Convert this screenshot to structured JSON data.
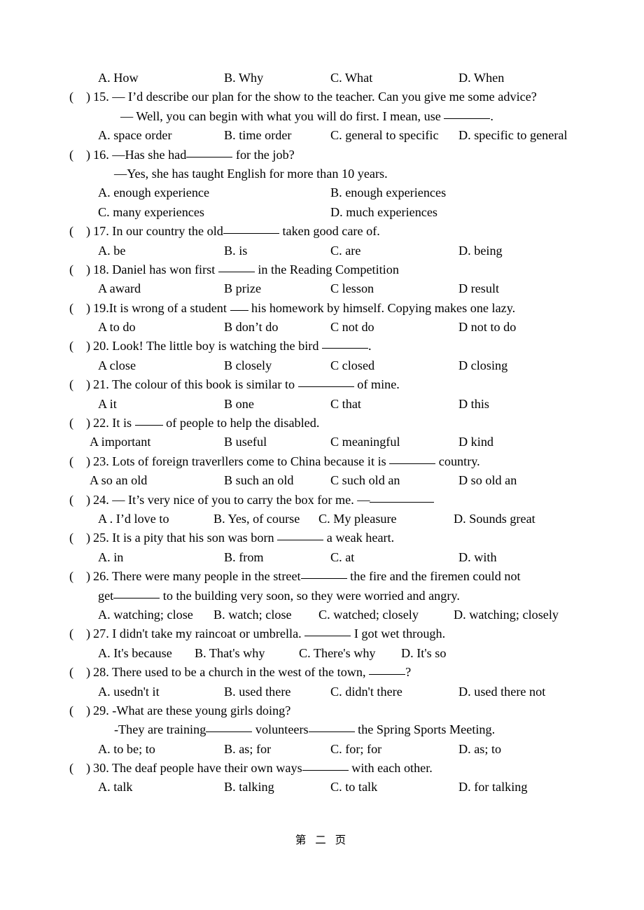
{
  "document": {
    "footer": "第 二 页",
    "bracket_open": "(",
    "bracket_close": ")"
  },
  "questions": [
    {
      "number": "",
      "options_layout": "four-column",
      "options": [
        "A. How",
        "B. Why",
        "C. What",
        "D. When"
      ]
    },
    {
      "number": "15.",
      "stem": "15. — I’d describe our plan for the show to the teacher. Can you give me some advice?",
      "stem_line2_pre": "— Well, you can begin with what you will do first. I mean, use ",
      "stem_line2_post": ".",
      "options_layout": "four-column",
      "options": [
        "A. space order",
        "B. time order",
        "C. general to specific",
        "D. specific to general"
      ]
    },
    {
      "number": "16.",
      "stem_pre": "16. —Has she had",
      "stem_post": " for the job?",
      "stem_line2": "—Yes, she has taught English for more than 10 years.",
      "options_layout": "two-column",
      "options": [
        "A. enough experience",
        "B. enough experiences",
        "C. many experiences",
        "D. much experiences"
      ]
    },
    {
      "number": "17.",
      "stem_pre": "17. In our country the old",
      "stem_post": " taken good care of.",
      "options_layout": "four-column",
      "options": [
        "A. be",
        "B. is",
        "C. are",
        "D. being"
      ]
    },
    {
      "number": "18.",
      "stem_pre": "18. Daniel has won first ",
      "stem_post": " in the Reading Competition",
      "options_layout": "four-column",
      "options": [
        "A award",
        "B prize",
        "C lesson",
        "D result"
      ]
    },
    {
      "number": "19.",
      "stem_pre": "19.It is wrong of a student ",
      "stem_post": " his homework by himself. Copying makes one lazy.",
      "options_layout": "four-column",
      "options": [
        "A to do",
        "B don’t do",
        "C not do",
        "D not to do"
      ]
    },
    {
      "number": "20.",
      "stem_pre": "20. Look! The little boy is watching the bird ",
      "stem_post": ".",
      "options_layout": "four-column",
      "options": [
        "A close",
        "B closely",
        "C closed",
        "D closing"
      ]
    },
    {
      "number": "21.",
      "stem_pre": "21. The colour of this book is similar to ",
      "stem_post": " of mine.",
      "options_layout": "four-column",
      "options": [
        "A it",
        "B one",
        "C that",
        "D this"
      ]
    },
    {
      "number": "22.",
      "stem_pre": "22. It is ",
      "stem_post": " of people to help the disabled.",
      "options_layout": "shift-left",
      "options": [
        "A important",
        "B useful",
        "C meaningful",
        "D kind"
      ]
    },
    {
      "number": "23.",
      "stem_pre": "23. Lots of foreign traverllers come to China because it is ",
      "stem_post": " country.",
      "options_layout": "shift-left",
      "options": [
        "A so an old",
        "B such an old",
        "C such old an",
        "D so old an"
      ]
    },
    {
      "number": "24.",
      "stem_pre": "24. — It’s very nice of you to carry the box for me. —",
      "stem_post": "",
      "options_layout": "flow-f",
      "options": [
        "A . I’d love to",
        "B. Yes, of course",
        "C. My pleasure",
        "D. Sounds great"
      ]
    },
    {
      "number": "25.",
      "stem_pre": "25. It is a pity that his son was born ",
      "stem_post": " a weak heart.",
      "options_layout": "four-column",
      "options": [
        "A. in",
        "B. from",
        "C. at",
        "D. with"
      ]
    },
    {
      "number": "26.",
      "stem_pre": "26. There were many people in the street",
      "stem_post": " the fire and the firemen could not",
      "stem_line2_pre": "get",
      "stem_line2_post": " to the building very soon, so they were worried and angry.",
      "options_layout": "flow-f",
      "options": [
        "A. watching; close",
        "B. watch; close",
        "C. watched; closely",
        "D. watching; closely"
      ]
    },
    {
      "number": "27.",
      "stem_pre": "27. I didn't take my raincoat or umbrella. ",
      "stem_post": " I got wet through.",
      "options_layout": "flow-g",
      "options": [
        "A. It's because",
        "B. That's why",
        "C. There's why",
        "D. It's so"
      ]
    },
    {
      "number": "28.",
      "stem_pre": "28. There used to be a church in the west of the town, ",
      "stem_post": "?",
      "options_layout": "four-column",
      "options": [
        "A. usedn't it",
        "B. used there",
        "C. didn't there",
        "D. used there not"
      ]
    },
    {
      "number": "29.",
      "stem": "29. -What are these young girls doing?",
      "stem_line2_pre": "-They are training",
      "stem_line2_mid": " volunteers",
      "stem_line2_post": " the Spring Sports Meeting.",
      "options_layout": "four-column",
      "options": [
        "A. to be; to",
        "B. as; for",
        "C. for; for",
        "D. as; to"
      ]
    },
    {
      "number": "30.",
      "stem_pre": "30. The deaf people have their own ways",
      "stem_post": " with each other.",
      "options_layout": "four-column",
      "options": [
        "A. talk",
        "B. talking",
        "C. to talk",
        "D. for talking"
      ]
    }
  ]
}
